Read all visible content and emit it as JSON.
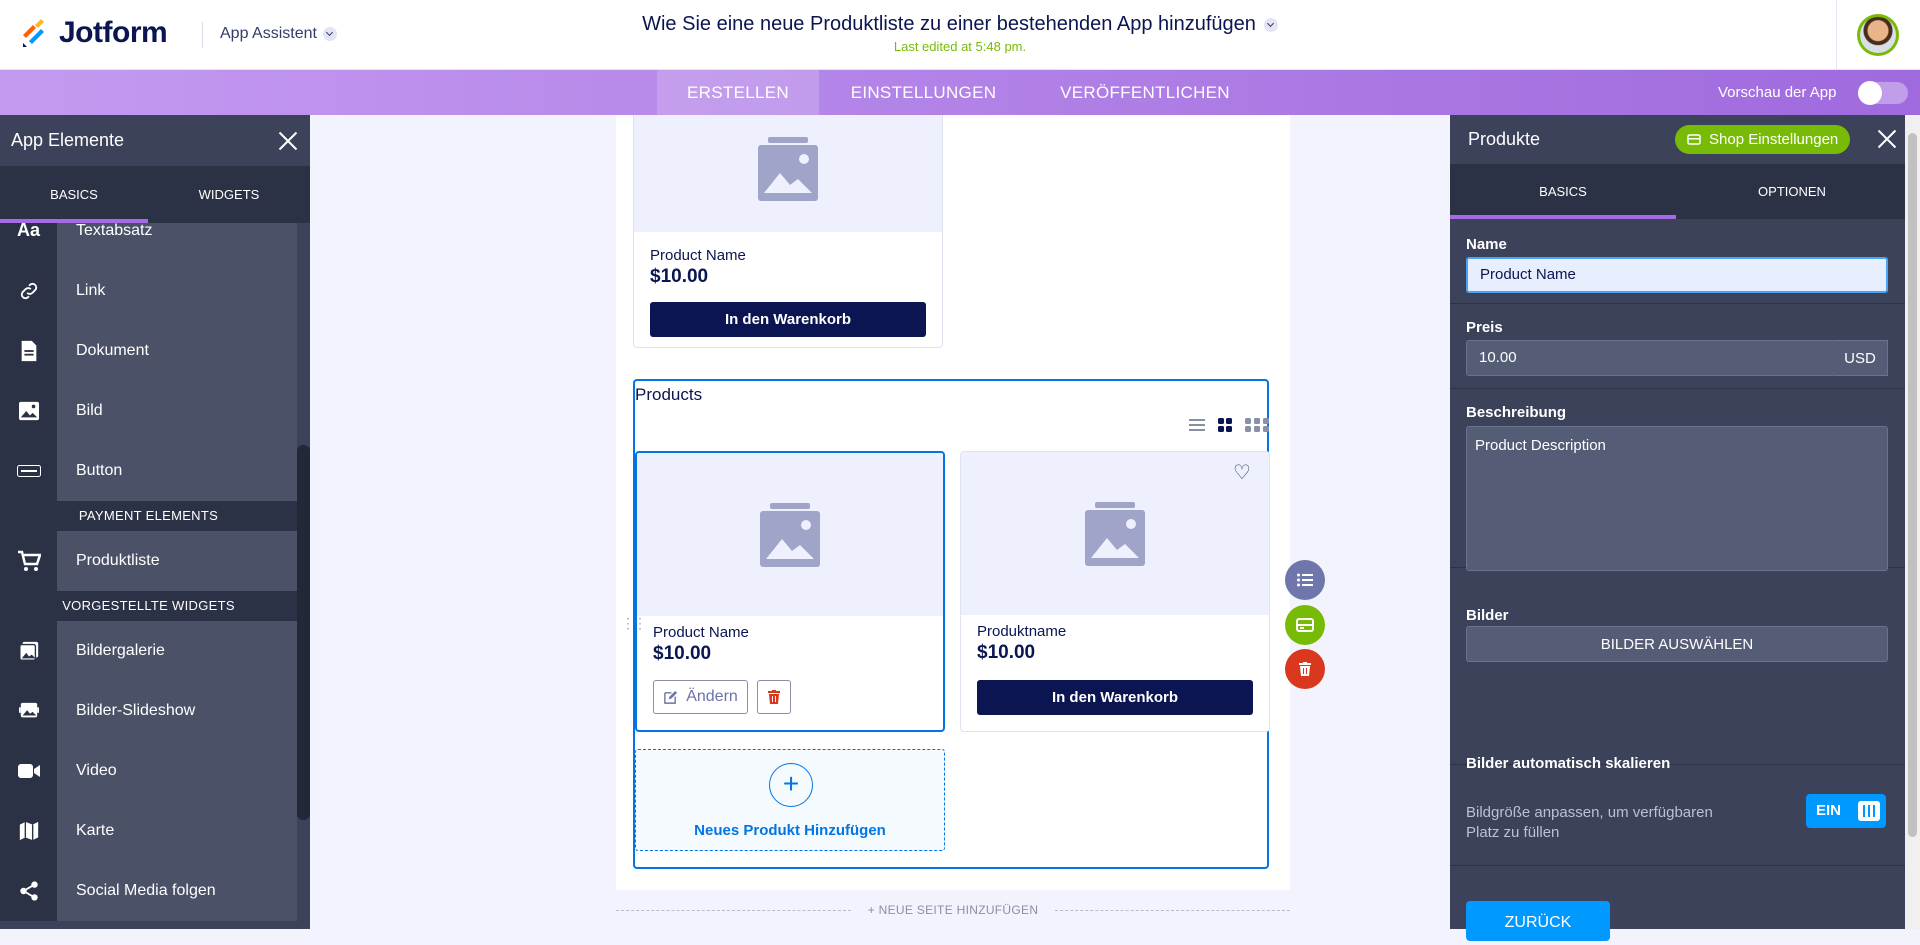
{
  "header": {
    "logo_text": "Jotform",
    "app_assistant": "App Assistent",
    "page_title": "Wie Sie eine neue Produktliste zu einer bestehenden App hinzufügen",
    "last_edited": "Last edited at 5:48 pm."
  },
  "nav": {
    "tabs": [
      "ERSTELLEN",
      "EINSTELLUNGEN",
      "VERÖFFENTLICHEN"
    ],
    "active_tab": "ERSTELLEN",
    "preview_label": "Vorschau der App",
    "preview_enabled": false
  },
  "left_panel": {
    "title": "App Elemente",
    "tabs": [
      "BASICS",
      "WIDGETS"
    ],
    "active_tab": "BASICS",
    "items": [
      {
        "label": "Textabsatz",
        "icon": "text-icon"
      },
      {
        "label": "Link",
        "icon": "link-icon"
      },
      {
        "label": "Dokument",
        "icon": "document-icon"
      },
      {
        "label": "Bild",
        "icon": "image-icon"
      },
      {
        "label": "Button",
        "icon": "button-icon"
      }
    ],
    "payment_section": "PAYMENT ELEMENTS",
    "payment_items": [
      {
        "label": "Produktliste",
        "icon": "cart-icon"
      }
    ],
    "widgets_section": "VORGESTELLTE WIDGETS",
    "widget_items": [
      {
        "label": "Bildergalerie",
        "icon": "gallery-icon"
      },
      {
        "label": "Bilder-Slideshow",
        "icon": "slideshow-icon"
      },
      {
        "label": "Video",
        "icon": "video-icon"
      },
      {
        "label": "Karte",
        "icon": "map-icon"
      },
      {
        "label": "Social Media folgen",
        "icon": "share-icon"
      }
    ]
  },
  "canvas": {
    "top_card": {
      "name": "Product Name",
      "price": "$10.00",
      "cart_label": "In den Warenkorb"
    },
    "widget_title": "Products",
    "products": [
      {
        "name": "Product Name",
        "price": "$10.00",
        "edit_label": "Ändern"
      },
      {
        "name": "Produktname",
        "price": "$10.00",
        "cart_label": "In den Warenkorb"
      }
    ],
    "add_product_label": "Neues Produkt Hinzufügen",
    "add_page_label": "+ NEUE SEITE HINZUFÜGEN"
  },
  "right_panel": {
    "title": "Produkte",
    "shop_settings_label": "Shop Einstellungen",
    "tabs": [
      "BASICS",
      "OPTIONEN"
    ],
    "active_tab": "BASICS",
    "name_label": "Name",
    "name_value": "Product Name",
    "price_label": "Preis",
    "price_value": "10.00",
    "currency": "USD",
    "description_label": "Beschreibung",
    "description_value": "Product Description",
    "images_label": "Bilder",
    "images_button": "BILDER AUSWÄHLEN",
    "autoscale_label": "Bilder automatisch skalieren",
    "autoscale_desc": "Bildgröße anpassen, um verfügbaren Platz zu füllen",
    "autoscale_toggle": "EIN",
    "back_button": "ZURÜCK"
  },
  "colors": {
    "accent_purple": "#a56ae6",
    "navy": "#0a1551",
    "blue": "#0075e3",
    "green": "#78bb07",
    "red": "#d9381e"
  }
}
